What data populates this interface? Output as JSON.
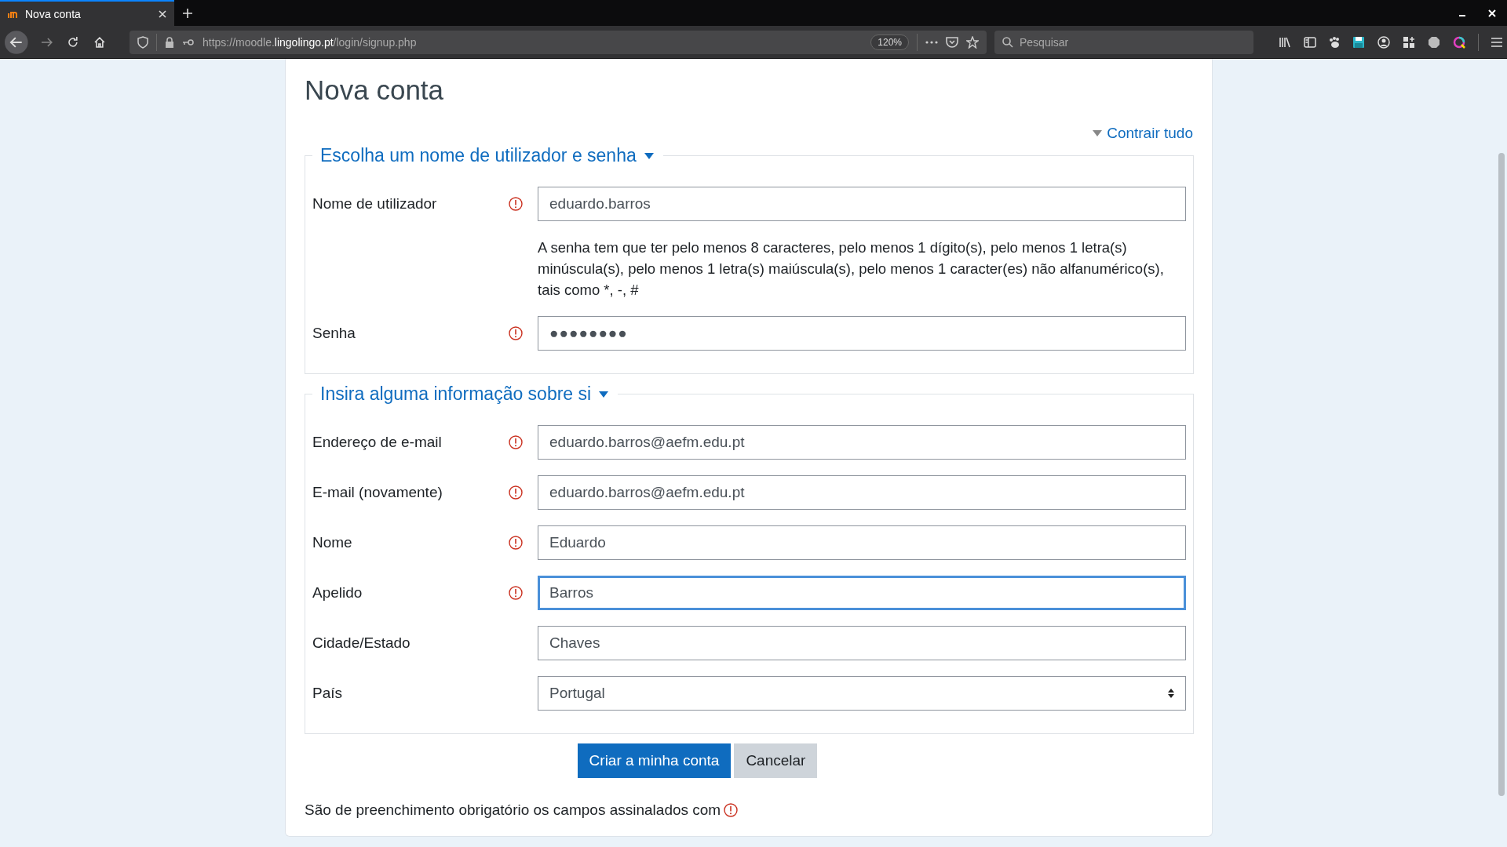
{
  "browser": {
    "tab": {
      "title": "Nova conta",
      "selected": true
    },
    "url": {
      "scheme": "https://moodle.",
      "host": "lingolingo.pt",
      "path": "/login/signup.php"
    },
    "zoom": "120%",
    "search": {
      "placeholder": "Pesquisar"
    }
  },
  "page": {
    "title": "Nova conta",
    "collapse_all": "Contrair tudo",
    "sections": [
      {
        "legend": "Escolha um nome de utilizador e senha",
        "expanded": true,
        "fields": [
          {
            "kind": "text",
            "label": "Nome de utilizador",
            "required": true,
            "value": "eduardo.barros",
            "focused": false
          },
          {
            "kind": "note",
            "text": "A senha tem que ter pelo menos 8 caracteres, pelo menos 1 dígito(s), pelo menos 1 letra(s) minúscula(s), pelo menos 1 letra(s) maiúscula(s), pelo menos 1 caracter(es) não alfanumérico(s), tais como *, -, #"
          },
          {
            "kind": "password",
            "label": "Senha",
            "required": true,
            "value": "●●●●●●●●",
            "focused": false
          }
        ]
      },
      {
        "legend": "Insira alguma informação sobre si",
        "expanded": true,
        "fields": [
          {
            "kind": "text",
            "label": "Endereço de e-mail",
            "required": true,
            "value": "eduardo.barros@aefm.edu.pt",
            "focused": false
          },
          {
            "kind": "text",
            "label": "E-mail (novamente)",
            "required": true,
            "value": "eduardo.barros@aefm.edu.pt",
            "focused": false
          },
          {
            "kind": "text",
            "label": "Nome",
            "required": true,
            "value": "Eduardo",
            "focused": false
          },
          {
            "kind": "text",
            "label": "Apelido",
            "required": true,
            "value": "Barros",
            "focused": true
          },
          {
            "kind": "text",
            "label": "Cidade/Estado",
            "required": false,
            "value": "Chaves",
            "focused": false
          },
          {
            "kind": "select",
            "label": "País",
            "required": false,
            "value": "Portugal",
            "focused": false
          }
        ]
      }
    ],
    "buttons": [
      {
        "label": "Criar a minha conta",
        "kind": "primary"
      },
      {
        "label": "Cancelar",
        "kind": "secondary"
      }
    ],
    "footer_note": "São de preenchimento obrigatório os campos assinalados com"
  }
}
